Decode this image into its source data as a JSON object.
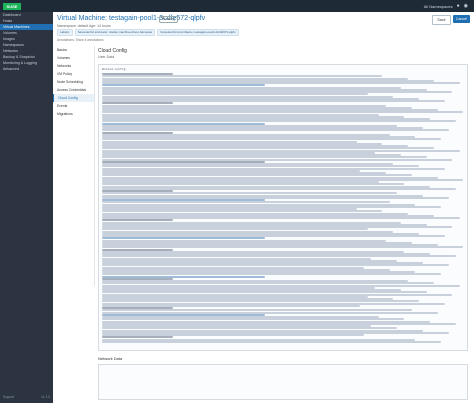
{
  "top": {
    "brand": "SUSE",
    "user": "All Namespaces"
  },
  "sidebar": {
    "items": [
      {
        "label": "Dashboard",
        "active": false
      },
      {
        "label": "Hosts",
        "active": false
      },
      {
        "label": "Virtual Machines",
        "active": true
      },
      {
        "label": "Volumes",
        "active": false
      },
      {
        "label": "Images",
        "active": false
      },
      {
        "label": "Namespaces",
        "active": false
      },
      {
        "label": "Networks",
        "active": false
      },
      {
        "label": "Backup & Snapshot",
        "active": false
      },
      {
        "label": "Monitoring & Logging",
        "active": false
      },
      {
        "label": "Advanced",
        "active": false
      }
    ],
    "footer_left": "Support",
    "footer_right": "v1.1.0"
  },
  "header": {
    "title": "Virtual Machine: testagain-pool1-3cdfe572-qlpfv",
    "status": "Running",
    "subline": "Namespace: default  Age: 14 hours",
    "save": "Save",
    "cancel": "Cancel"
  },
  "tags": [
    "Labels:",
    "harvesterhci.io/creator: docker-machine-driver-harvester",
    "harvesterhci.io/vmName: testagain-pool1-3cdfe572-qlpfv"
  ],
  "subline2": "Annotations: Show 4 annotations",
  "leftnav": [
    {
      "label": "Basics",
      "active": false
    },
    {
      "label": "Volumes",
      "active": false
    },
    {
      "label": "Networks",
      "active": false
    },
    {
      "label": "VM Policy",
      "active": false
    },
    {
      "label": "Node Scheduling",
      "active": false
    },
    {
      "label": "Access Credentials",
      "active": false
    },
    {
      "label": "Cloud Config",
      "active": true
    },
    {
      "label": "Events",
      "active": false
    },
    {
      "label": "Migrations",
      "active": false
    }
  ],
  "content": {
    "heading": "Cloud Config",
    "userdata": "User Data",
    "code_head": "#cloud-config",
    "network": "Network Data"
  }
}
